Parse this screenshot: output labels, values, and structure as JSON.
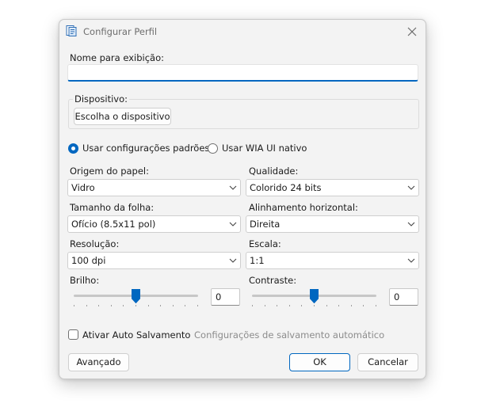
{
  "window": {
    "title": "Configurar Perfil",
    "app_icon": "scanner-profile-icon",
    "close_icon": "close-icon"
  },
  "name_label": "Nome para exibição:",
  "name_value": "",
  "device": {
    "group_label": "Dispositivo:",
    "choose_button": "Escolha o dispositivo"
  },
  "mode": {
    "default_label": "Usar configurações padrões",
    "native_label": "Usar WIA UI nativo",
    "selected": "default"
  },
  "settings": {
    "paper_source": {
      "label": "Origem do papel:",
      "value": "Vidro"
    },
    "quality": {
      "label": "Qualidade:",
      "value": "Colorido 24 bits"
    },
    "page_size": {
      "label": "Tamanho da folha:",
      "value": "Ofício (8.5x11 pol)"
    },
    "horizontal_align": {
      "label": "Alinhamento horizontal:",
      "value": "Direita"
    },
    "resolution": {
      "label": "Resolução:",
      "value": "100 dpi"
    },
    "scale": {
      "label": "Escala:",
      "value": "1:1"
    },
    "brightness": {
      "label": "Brilho:",
      "value": "0",
      "level": 0.5
    },
    "contrast": {
      "label": "Contraste:",
      "value": "0",
      "level": 0.5
    }
  },
  "autosave": {
    "checkbox_label": "Ativar Auto Salvamento",
    "checked": false,
    "settings_link": "Configurações de salvamento automático"
  },
  "buttons": {
    "advanced": "Avançado",
    "ok": "OK",
    "cancel": "Cancelar"
  },
  "colors": {
    "accent": "#0067c0",
    "dialog_bg": "#f3f3f3"
  }
}
